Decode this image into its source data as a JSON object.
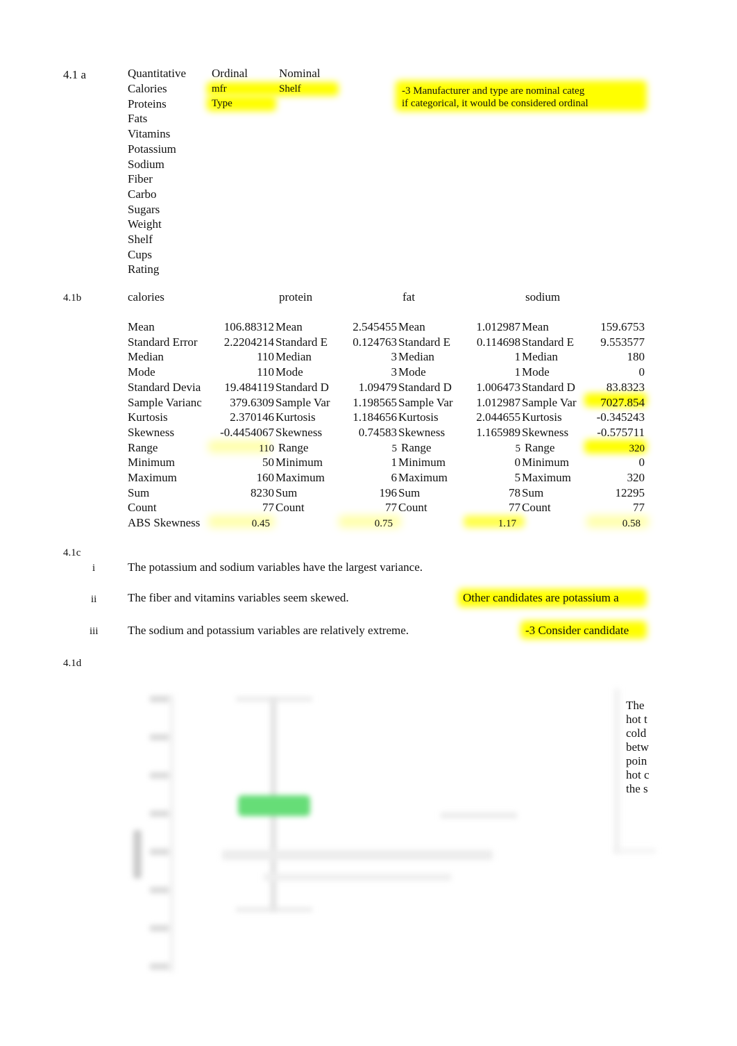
{
  "section_a": {
    "label": "4.1 a",
    "headers": {
      "quantitative": "Quantitative",
      "ordinal": "Ordinal",
      "nominal": "Nominal"
    },
    "quantitative": [
      "Calories",
      "Proteins",
      "Fats",
      "Vitamins",
      "Potassium",
      "Sodium",
      "Fiber",
      "Carbo",
      "Sugars",
      "Weight",
      "Shelf",
      "Cups",
      "Rating"
    ],
    "ordinal": [
      "mfr",
      "Type"
    ],
    "nominal": [
      "Shelf"
    ],
    "comment_line1": "-3   Manufacturer and type are nominal categ",
    "comment_line2": "if categorical, it would be considered ordinal",
    "highlight_color": "#ffff00"
  },
  "section_b": {
    "label": "4.1b",
    "columns": [
      "calories",
      "protein",
      "fat",
      "sodium"
    ],
    "stat_labels_full": [
      "Mean",
      "Standard Error",
      "Median",
      "Mode",
      "Standard Devia",
      "Sample Varianc",
      "Kurtosis",
      "Skewness",
      "Range",
      "Minimum",
      "Maximum",
      "Sum",
      "Count",
      "ABS Skewness"
    ],
    "stat_labels_short": [
      "Mean",
      "Standard E",
      "Median",
      "Mode",
      "Standard D",
      "Sample Var",
      "Kurtosis",
      "Skewness",
      "Range",
      "Minimum",
      "Maximum",
      "Sum",
      "Count"
    ],
    "values": {
      "calories": [
        "106.88312",
        "2.2204214",
        "110",
        "110",
        "19.484119",
        "379.6309",
        "2.370146",
        "-0.4454067",
        "110",
        "50",
        "160",
        "8230",
        "77",
        "0.45"
      ],
      "protein": [
        "2.545455",
        "0.124763",
        "3",
        "3",
        "1.09479",
        "1.198565",
        "1.184656",
        "0.74583",
        "5",
        "1",
        "6",
        "196",
        "77",
        "0.75"
      ],
      "fat": [
        "1.012987",
        "0.114698",
        "1",
        "1",
        "1.006473",
        "1.012987",
        "2.044655",
        "1.165989",
        "5",
        "0",
        "5",
        "78",
        "77",
        "1.17"
      ],
      "sodium": [
        "159.6753",
        "9.553577",
        "180",
        "0",
        "83.8323",
        "7027.854",
        "-0.345243",
        "-0.575711",
        "320",
        "0",
        "320",
        "12295",
        "77",
        "0.58"
      ]
    }
  },
  "section_c": {
    "label": "4.1c",
    "items": [
      {
        "num": "i",
        "text": "The potassium and sodium variables have the largest variance."
      },
      {
        "num": "ii",
        "text": "The fiber and vitamins variables seem skewed.",
        "comment": "Other candidates are potassium a"
      },
      {
        "num": "iii",
        "text": "The sodium and potassium variables are relatively extreme.",
        "comment": "-3  Consider candidate"
      }
    ]
  },
  "section_d": {
    "label": "4.1d",
    "side_note_lines": [
      "The",
      "hot t",
      "cold",
      "betw",
      "poin",
      "hot c",
      "the s"
    ],
    "box_color": "#66dd77"
  }
}
